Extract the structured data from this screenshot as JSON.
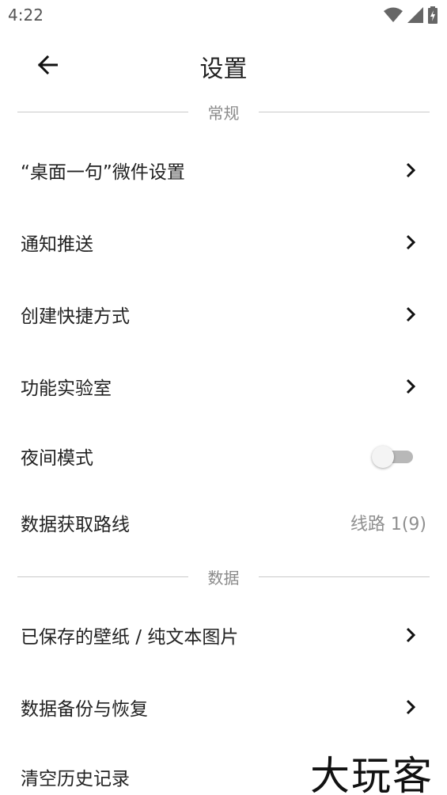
{
  "status_bar": {
    "time": "4:22",
    "icons": [
      "wifi-icon",
      "signal-icon",
      "battery-charging-icon"
    ]
  },
  "app_bar": {
    "title": "设置",
    "back_icon": "arrow-left-icon"
  },
  "sections": {
    "general": "常规",
    "data": "数据"
  },
  "items": {
    "widget": {
      "label": "“桌面一句”微件设置",
      "icon": "chevron-right-icon"
    },
    "notify": {
      "label": "通知推送",
      "icon": "chevron-right-icon"
    },
    "shortcut": {
      "label": "创建快捷方式",
      "icon": "chevron-right-icon"
    },
    "lab": {
      "label": "功能实验室",
      "icon": "chevron-right-icon"
    },
    "night_mode": {
      "label": "夜间模式",
      "enabled": false
    },
    "route": {
      "label": "数据获取路线",
      "value": "线路 1(9)"
    },
    "saved": {
      "label": "已保存的壁纸 / 纯文本图片",
      "icon": "chevron-right-icon"
    },
    "backup": {
      "label": "数据备份与恢复",
      "icon": "chevron-right-icon"
    },
    "clear": {
      "label": "清空历史记录"
    }
  },
  "watermark": {
    "text": "大玩客"
  }
}
